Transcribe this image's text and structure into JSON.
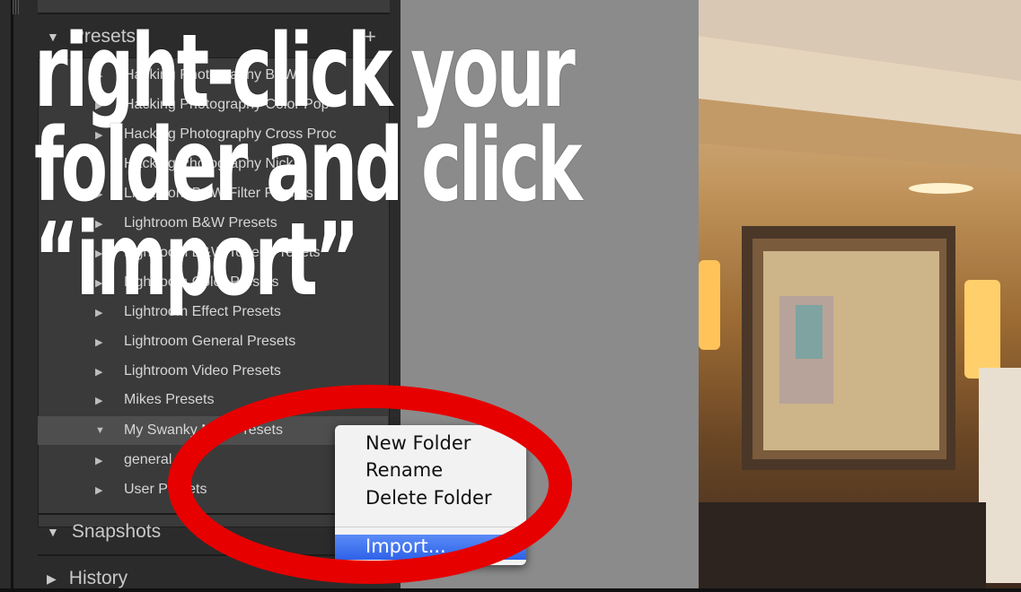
{
  "panel": {
    "presets_header": "Presets",
    "snapshots_header": "Snapshots",
    "history_header": "History",
    "add_label": "+",
    "presets": [
      "Hacking Photography B+W",
      "Hacking Photography Color Pop",
      "Hacking Photography Cross Proc",
      "Hacking Photography Nick",
      "Lightroom B&W Filter Presets",
      "Lightroom B&W Presets",
      "Lightroom B&W Toned Presets",
      "Lightroom Color Presets",
      "Lightroom Effect Presets",
      "Lightroom General Presets",
      "Lightroom Video Presets",
      "Mikes Presets",
      "My Swanky New Presets",
      "general",
      "User Presets"
    ]
  },
  "context_menu": {
    "items": [
      "New Folder",
      "Rename",
      "Delete Folder"
    ],
    "highlighted": "Import..."
  },
  "caption": {
    "line1": "right-click your",
    "line2": "folder and click",
    "line3": "“import”"
  },
  "colors": {
    "annotation_ellipse": "#e60000",
    "menu_highlight": "#3a6cf0"
  }
}
